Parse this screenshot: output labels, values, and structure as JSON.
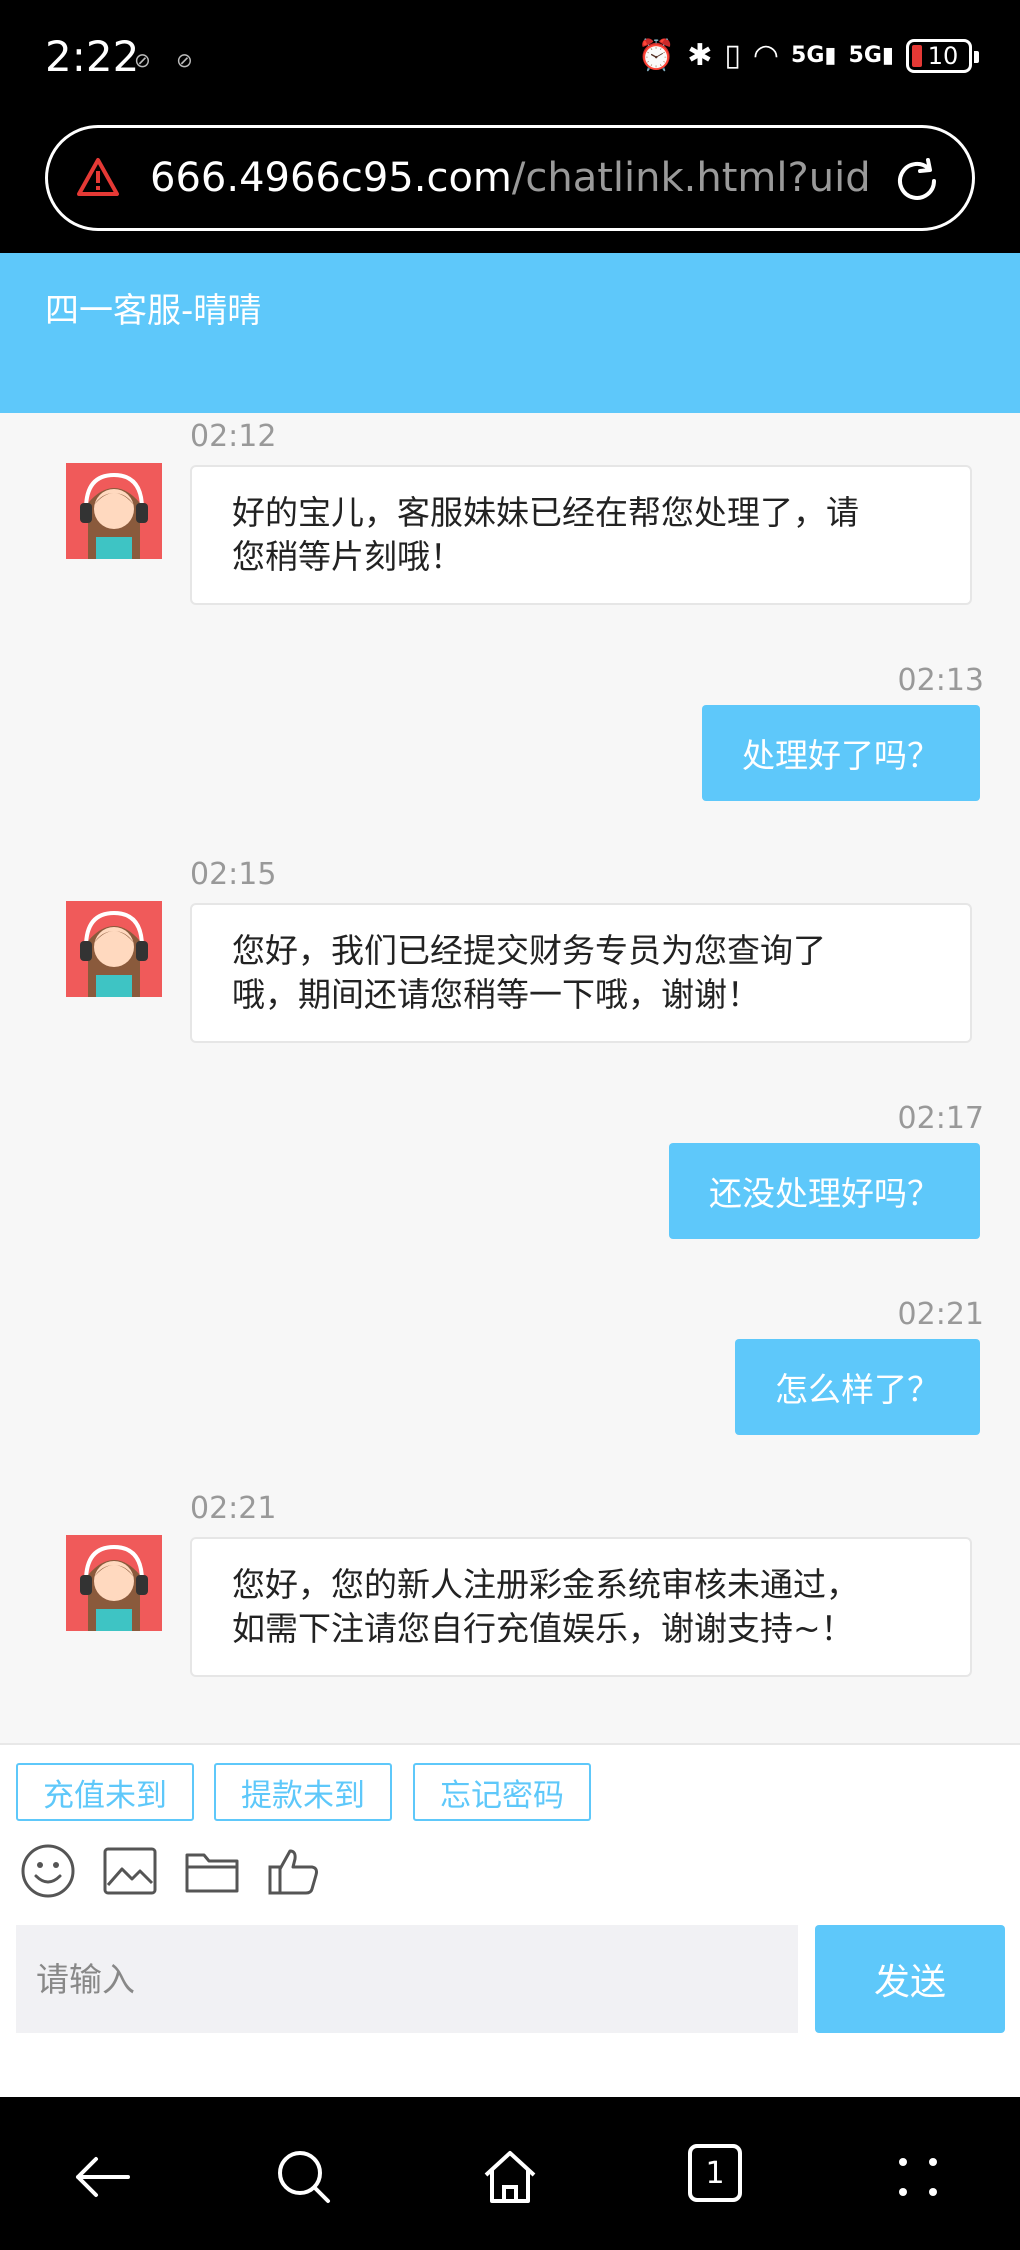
{
  "status_bar": {
    "time": "2:22",
    "network_labels": [
      "5G",
      "5G"
    ],
    "battery": "10"
  },
  "browser": {
    "url_host": "666.4966c95.com",
    "url_path": "/chatlink.html?uid="
  },
  "chat": {
    "title": "四一客服-晴晴",
    "messages": [
      {
        "side": "left",
        "time": "02:12",
        "text_lines": [
          "好的宝儿，客服妹妹已经在帮您处理了，请",
          "您稍等片刻哦！"
        ]
      },
      {
        "side": "right",
        "time": "02:13",
        "text": "处理好了吗？"
      },
      {
        "side": "left",
        "time": "02:15",
        "text_lines": [
          "您好，我们已经提交财务专员为您查询了",
          "哦，期间还请您稍等一下哦，谢谢！"
        ]
      },
      {
        "side": "right",
        "time": "02:17",
        "text": "还没处理好吗？"
      },
      {
        "side": "right",
        "time": "02:21",
        "text": "怎么样了？"
      },
      {
        "side": "left",
        "time": "02:21",
        "text_lines": [
          "您好，您的新人注册彩金系统审核未通过，",
          "如需下注请您自行充值娱乐，谢谢支持~！"
        ]
      }
    ]
  },
  "quick_replies": [
    "充值未到",
    "提款未到",
    "忘记密码"
  ],
  "composer": {
    "placeholder": "请输入",
    "send_label": "发送"
  },
  "nav": {
    "tab_count": "1"
  },
  "colors": {
    "accent": "#5ec8fa",
    "avatar_bg": "#f05a5a"
  }
}
